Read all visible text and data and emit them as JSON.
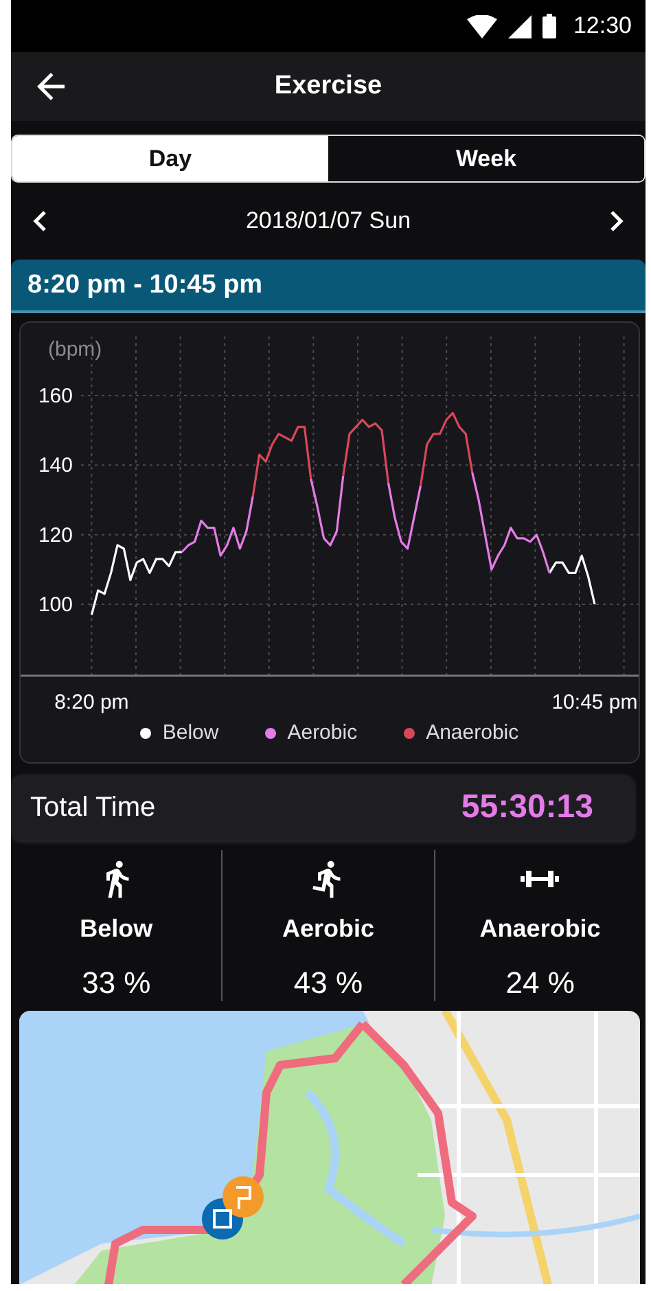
{
  "status_bar": {
    "time": "12:30"
  },
  "app_bar": {
    "title": "Exercise"
  },
  "tabs": [
    {
      "label": "Day",
      "selected": true
    },
    {
      "label": "Week",
      "selected": false
    }
  ],
  "date_nav": {
    "date": "2018/01/07 Sun"
  },
  "session": {
    "time_range": "8:20 pm - 10:45 pm"
  },
  "heart_rate_chart": {
    "chart_data": {
      "type": "line",
      "ylabel": "(bpm)",
      "grid": true,
      "ylim": [
        79.5,
        160
      ],
      "yticks": [
        100,
        120,
        140,
        160
      ],
      "categories": [
        "8:20 pm",
        null,
        null,
        null,
        null,
        null,
        null,
        null,
        null,
        null,
        null,
        null,
        null,
        null,
        null,
        null,
        null,
        null,
        null,
        null,
        null,
        null,
        null,
        null,
        null,
        null,
        null,
        null,
        null,
        null,
        null,
        null,
        null,
        null,
        null,
        null,
        null,
        null,
        null,
        null,
        null,
        null,
        null,
        null,
        null,
        null,
        null,
        null,
        null,
        null,
        null,
        null,
        null,
        null,
        null,
        null,
        null,
        null,
        null,
        null,
        null,
        null,
        null,
        null,
        null,
        null,
        null,
        null,
        null,
        null,
        null,
        null,
        null,
        null,
        null,
        null,
        null,
        null,
        "10:45 pm"
      ],
      "series": [
        {
          "name": "Below",
          "color": "#ffffff",
          "values": [
            97,
            104,
            103,
            109,
            117,
            116,
            107,
            112,
            113,
            109,
            113,
            113,
            111,
            115,
            115,
            null,
            null,
            null,
            null,
            null,
            null,
            null,
            null,
            null,
            null,
            null,
            null,
            null,
            null,
            null,
            null,
            null,
            null,
            null,
            null,
            null,
            null,
            null,
            null,
            null,
            null,
            null,
            null,
            null,
            null,
            null,
            null,
            null,
            null,
            null,
            null,
            null,
            null,
            null,
            null,
            null,
            null,
            null,
            null,
            null,
            null,
            null,
            null,
            null,
            null,
            null,
            null,
            null,
            null,
            null,
            null,
            109,
            112,
            112,
            109,
            109,
            114,
            108,
            100
          ]
        },
        {
          "name": "Aerobic",
          "color": "#e47be8",
          "values": [
            null,
            null,
            null,
            null,
            null,
            null,
            null,
            null,
            null,
            null,
            null,
            null,
            null,
            null,
            115,
            117,
            118,
            124,
            122,
            122,
            114,
            117,
            122,
            116,
            121,
            131,
            null,
            null,
            null,
            null,
            null,
            null,
            null,
            null,
            136,
            128,
            119,
            117,
            121,
            137,
            null,
            null,
            null,
            null,
            null,
            null,
            135,
            125,
            118,
            116,
            125,
            134,
            null,
            null,
            null,
            null,
            null,
            null,
            null,
            138,
            130,
            120,
            110,
            114,
            117,
            122,
            119,
            119,
            118,
            120,
            115,
            109,
            null,
            null,
            null,
            null,
            null,
            null,
            null
          ]
        },
        {
          "name": "Anaerobic",
          "color": "#d9475a",
          "values": [
            null,
            null,
            null,
            null,
            null,
            null,
            null,
            null,
            null,
            null,
            null,
            null,
            null,
            null,
            null,
            null,
            null,
            null,
            null,
            null,
            null,
            null,
            null,
            null,
            null,
            131,
            143,
            141,
            146,
            149,
            148,
            147,
            151,
            151,
            136,
            null,
            null,
            null,
            null,
            137,
            149,
            151,
            153,
            151,
            152,
            150,
            135,
            null,
            null,
            null,
            null,
            134,
            146,
            149,
            149,
            153,
            155,
            151,
            149,
            138,
            null,
            null,
            null,
            null,
            null,
            null,
            null,
            null,
            null,
            null,
            null,
            null,
            null,
            null,
            null,
            null,
            null,
            null,
            null
          ]
        }
      ]
    }
  },
  "total_time": {
    "label": "Total Time",
    "value": "55:30:13"
  },
  "zones": [
    {
      "kind": "walk",
      "label": "Below",
      "percent": "33 %"
    },
    {
      "kind": "run",
      "label": "Aerobic",
      "percent": "43 %"
    },
    {
      "kind": "lift",
      "label": "Anaerobic",
      "percent": "24 %"
    }
  ]
}
